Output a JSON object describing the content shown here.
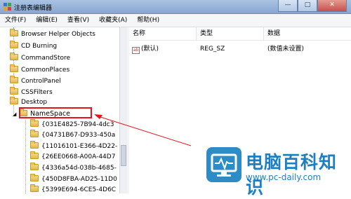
{
  "window": {
    "title": "注册表编辑器",
    "controls": [
      "minimize",
      "maximize",
      "close"
    ]
  },
  "menu": [
    "文件(F)",
    "编辑(E)",
    "查看(V)",
    "收藏夹(A)",
    "帮助(H)"
  ],
  "tree": {
    "items": [
      {
        "label": "Browser Helper Objects",
        "expanded": false
      },
      {
        "label": "CD Burning",
        "expanded": false
      },
      {
        "label": "CommandStore",
        "expanded": false
      },
      {
        "label": "CommonPlaces",
        "expanded": false
      },
      {
        "label": "ControlPanel",
        "expanded": false
      },
      {
        "label": "CSSFilters",
        "expanded": false
      },
      {
        "label": "Desktop",
        "expanded": false
      },
      {
        "label": "NameSpace",
        "expanded": true,
        "highlighted": true
      },
      {
        "label": "{031E4825-7B94-4dc3",
        "child": true
      },
      {
        "label": "{04731B67-D933-450a",
        "child": true
      },
      {
        "label": "{11016101-E366-4D22-",
        "child": true
      },
      {
        "label": "{26EE0668-A00A-44D7",
        "child": true
      },
      {
        "label": "{4336a54d-038b-4685-",
        "child": true
      },
      {
        "label": "{450D8FBA-AD25-11D0",
        "child": true
      },
      {
        "label": "{5399E694-6CE5-4D6C",
        "child": true
      }
    ]
  },
  "list": {
    "columns": [
      "名称",
      "类型",
      "数据"
    ],
    "rows": [
      {
        "name": "(默认)",
        "type": "REG_SZ",
        "data": "(数值未设置)",
        "icon": "ab-string-icon"
      }
    ]
  },
  "watermark": {
    "title": "电脑百科知识",
    "url": "www.pc-daily.com"
  },
  "colors": {
    "highlight_border": "#e3141b",
    "arrow": "#e3141b",
    "watermark": "#1d7fc2"
  }
}
